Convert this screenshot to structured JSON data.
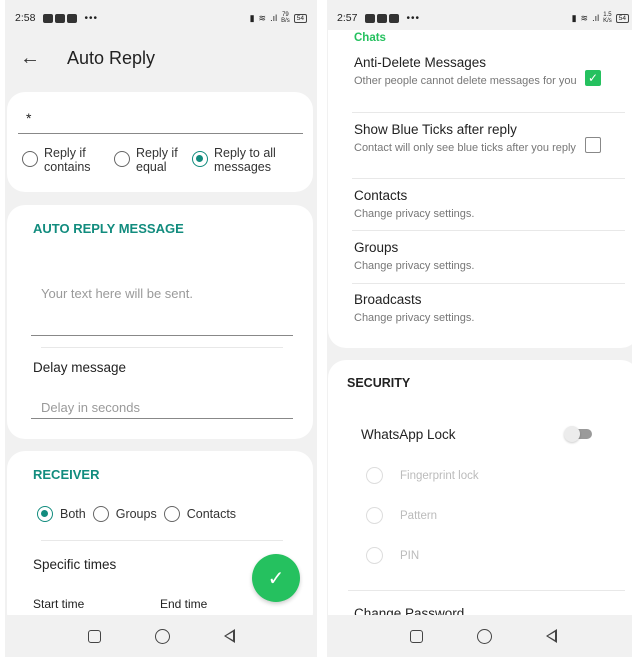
{
  "left_screen": {
    "status_bar": {
      "time": "2:58",
      "net_speed_value": "79",
      "net_speed_unit": "B/s",
      "battery": "54"
    },
    "app_bar": {
      "back_icon": "arrow-left-icon",
      "title": "Auto Reply"
    },
    "keyword_card": {
      "keyword_value": "*",
      "match_options": [
        {
          "label": "Reply if contains",
          "selected": false
        },
        {
          "label": "Reply if equal",
          "selected": false
        },
        {
          "label": "Reply to all messages",
          "selected": true
        }
      ]
    },
    "message_card": {
      "heading": "AUTO REPLY MESSAGE",
      "message_placeholder": "Your text here will be sent.",
      "delay_label": "Delay message",
      "delay_placeholder": "Delay in seconds"
    },
    "receiver_card": {
      "heading": "RECEIVER",
      "options": [
        {
          "label": "Both",
          "selected": true
        },
        {
          "label": "Groups",
          "selected": false
        },
        {
          "label": "Contacts",
          "selected": false
        }
      ],
      "specific_times_label": "Specific times",
      "start_time_label": "Start time",
      "end_time_label": "End time"
    },
    "fab": {
      "icon": "check-icon",
      "color": "#25c15f"
    }
  },
  "right_screen": {
    "status_bar": {
      "time": "2:57",
      "net_speed_value": "1.5",
      "net_speed_unit": "K/s",
      "battery": "54"
    },
    "chats_card": {
      "section_label": "Chats",
      "items": [
        {
          "title": "Anti-Delete Messages",
          "subtitle": "Other people cannot delete messages for you",
          "checked": true
        },
        {
          "title": "Show Blue Ticks after reply",
          "subtitle": "Contact will only see blue ticks after you reply",
          "checked": false
        },
        {
          "title": "Contacts",
          "subtitle": "Change privacy settings."
        },
        {
          "title": "Groups",
          "subtitle": "Change privacy settings."
        },
        {
          "title": "Broadcasts",
          "subtitle": "Change privacy settings."
        }
      ]
    },
    "security_card": {
      "heading": "SECURITY",
      "lock_label": "WhatsApp Lock",
      "lock_enabled": false,
      "lock_options": [
        "Fingerprint lock",
        "Pattern",
        "PIN"
      ],
      "change_password_label": "Change Password"
    }
  },
  "colors": {
    "accent_teal": "#128c7e",
    "accent_green": "#25c15f"
  }
}
